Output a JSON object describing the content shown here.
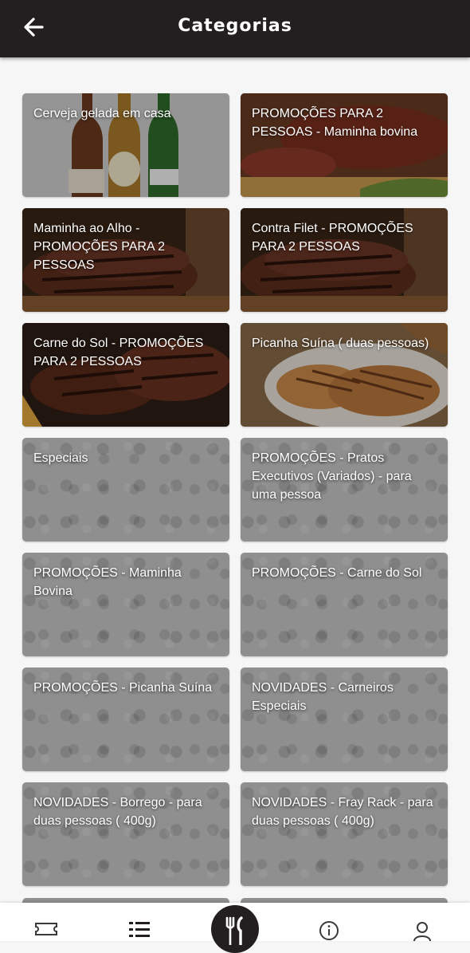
{
  "header": {
    "title": "Categorias",
    "back_icon": "arrow-left-icon"
  },
  "categories": [
    {
      "label": "Cerveja gelada em casa",
      "kind": "photo",
      "photo": "beer-bottles"
    },
    {
      "label": "PROMOÇÕES PARA 2 PESSOAS - Maminha bovina",
      "kind": "photo",
      "photo": "roast-beef"
    },
    {
      "label": "Maminha ao Alho - PROMOÇÕES PARA 2 PESSOAS",
      "kind": "photo",
      "photo": "grilled-steak"
    },
    {
      "label": "Contra Filet - PROMOÇÕES PARA 2 PESSOAS",
      "kind": "photo",
      "photo": "grilled-steak"
    },
    {
      "label": "Carne do Sol - PROMOÇÕES PARA 2 PESSOAS",
      "kind": "photo",
      "photo": "steak-fries"
    },
    {
      "label": "Picanha Suína ( duas pessoas)",
      "kind": "photo",
      "photo": "pork-chops"
    },
    {
      "label": "Especiais",
      "kind": "pattern"
    },
    {
      "label": "PROMOÇÕES - Pratos Executivos (Variados) - para uma pessoa",
      "kind": "pattern"
    },
    {
      "label": "PROMOÇÕES - Maminha Bovina",
      "kind": "pattern"
    },
    {
      "label": "PROMOÇÕES - Carne do Sol",
      "kind": "pattern"
    },
    {
      "label": "PROMOÇÕES - Picanha Suína",
      "kind": "pattern"
    },
    {
      "label": "NOVIDADES - Carneiros Especiais",
      "kind": "pattern"
    },
    {
      "label": "NOVIDADES - Borrego - para duas pessoas ( 400g)",
      "kind": "pattern"
    },
    {
      "label": "NOVIDADES - Fray Rack - para duas pessoas ( 400g)",
      "kind": "pattern"
    }
  ],
  "bottom_nav": {
    "items": [
      {
        "icon": "ticket-icon"
      },
      {
        "icon": "list-icon",
        "active": true
      },
      {
        "icon": "fork-knife-icon",
        "center": true
      },
      {
        "icon": "info-icon"
      },
      {
        "icon": "user-icon"
      }
    ]
  },
  "colors": {
    "header_bg": "#231f20",
    "page_bg": "#f6f6f6",
    "card_pattern": "#8f8f8f"
  }
}
